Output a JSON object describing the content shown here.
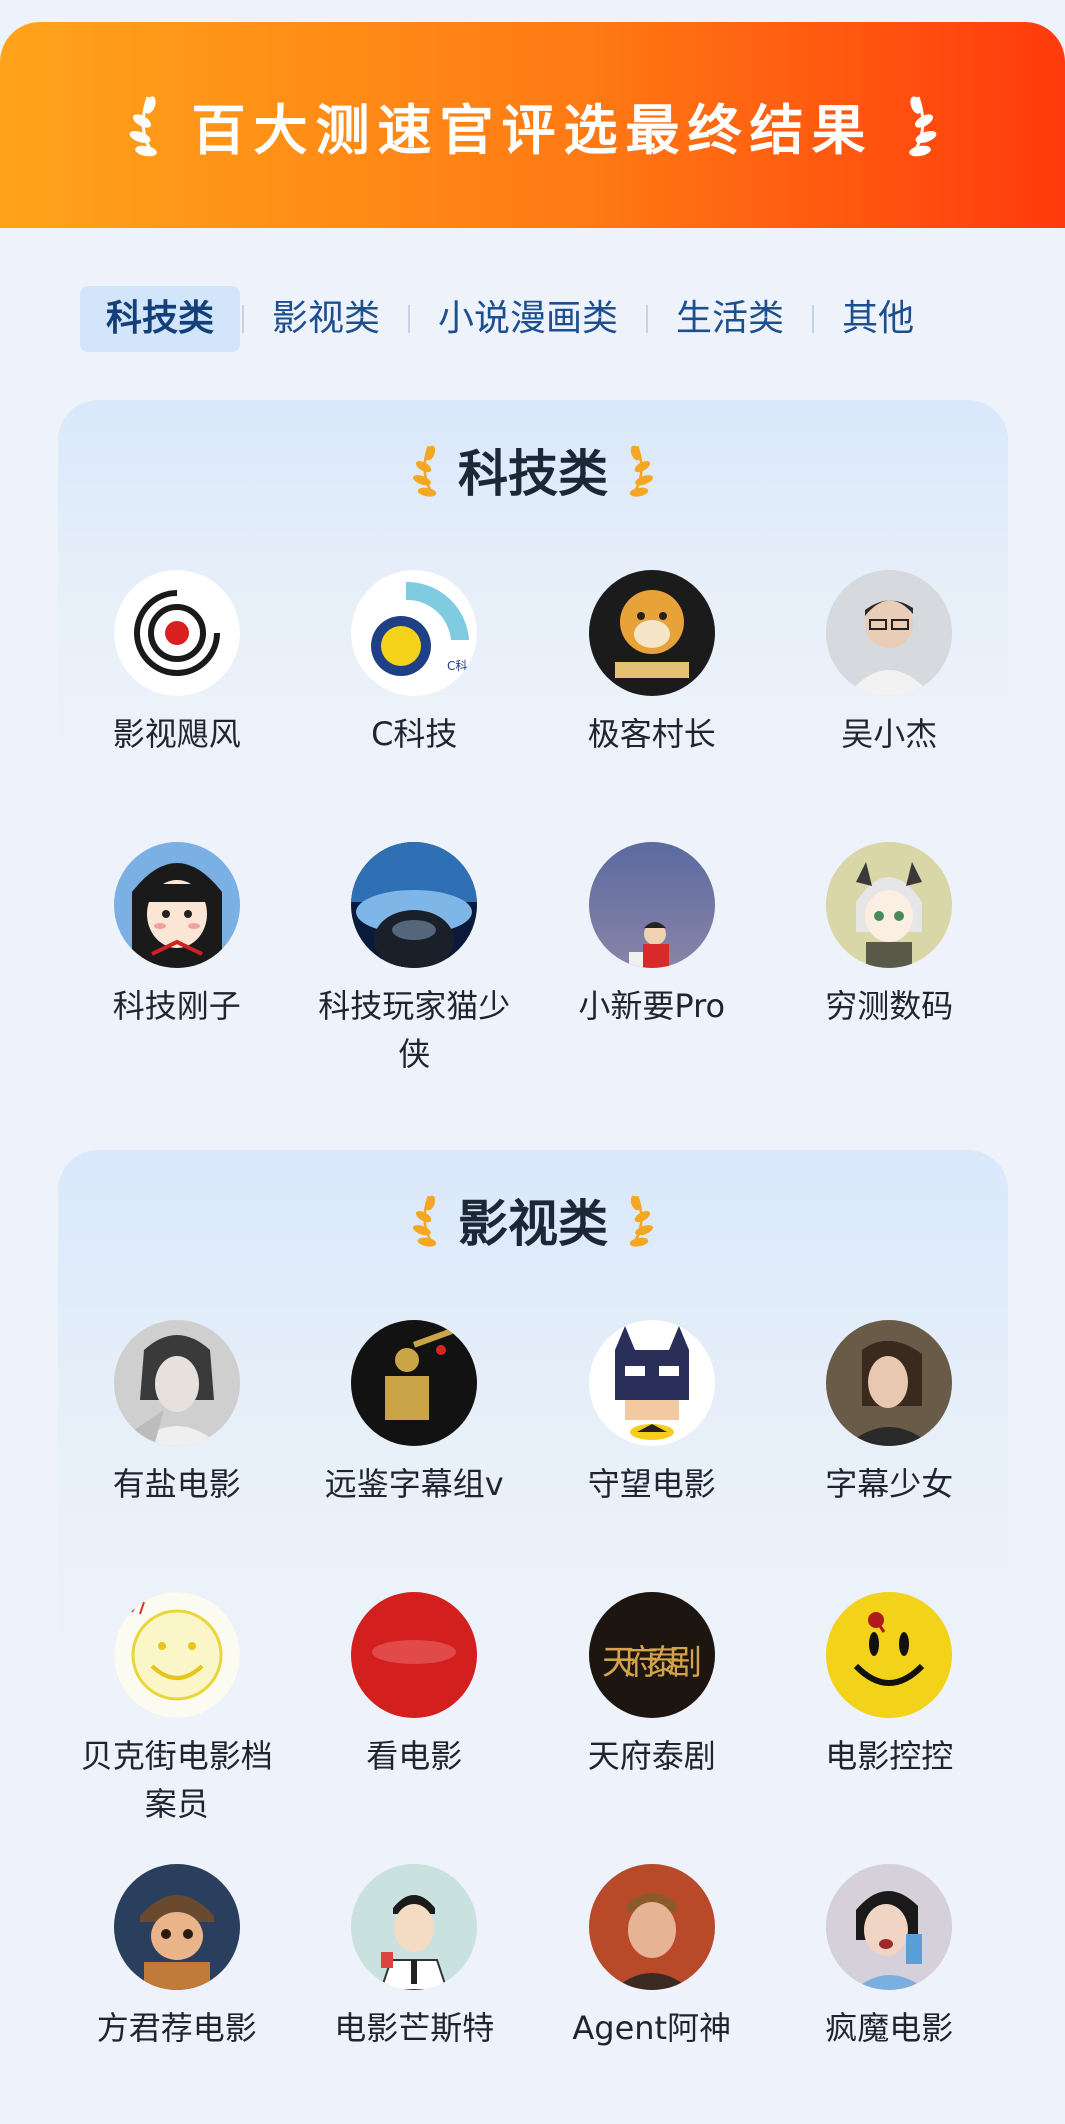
{
  "banner": {
    "title": "百大测速官评选最终结果"
  },
  "tabs": [
    {
      "label": "科技类",
      "active": true
    },
    {
      "label": "影视类",
      "active": false
    },
    {
      "label": "小说漫画类",
      "active": false
    },
    {
      "label": "生活类",
      "active": false
    },
    {
      "label": "其他",
      "active": false
    }
  ],
  "sections": {
    "tech": {
      "title": "科技类",
      "items": [
        {
          "name": "影视飓风"
        },
        {
          "name": "C科技"
        },
        {
          "name": "极客村长"
        },
        {
          "name": "吴小杰"
        },
        {
          "name": "科技刚子"
        },
        {
          "name": "科技玩家猫少侠"
        },
        {
          "name": "小新要Pro"
        },
        {
          "name": "穷测数码"
        }
      ]
    },
    "film": {
      "title": "影视类",
      "items": [
        {
          "name": "有盐电影"
        },
        {
          "name": "远鉴字幕组v"
        },
        {
          "name": "守望电影"
        },
        {
          "name": "字幕少女"
        },
        {
          "name": "贝克街电影档案员"
        },
        {
          "name": "看电影"
        },
        {
          "name": "天府泰剧"
        },
        {
          "name": "电影控控"
        },
        {
          "name": "方君荐电影"
        },
        {
          "name": "电影芒斯特"
        },
        {
          "name": "Agent阿神"
        },
        {
          "name": "疯魔电影"
        }
      ]
    }
  },
  "avatar_labels": {
    "c_tech": "C科",
    "tianfu": "天府泰剧"
  },
  "colors": {
    "banner_start": "#ffa41a",
    "banner_end": "#ff3a0c",
    "tab_active_bg": "#d3e5fa",
    "laurel": "#f5a623"
  }
}
